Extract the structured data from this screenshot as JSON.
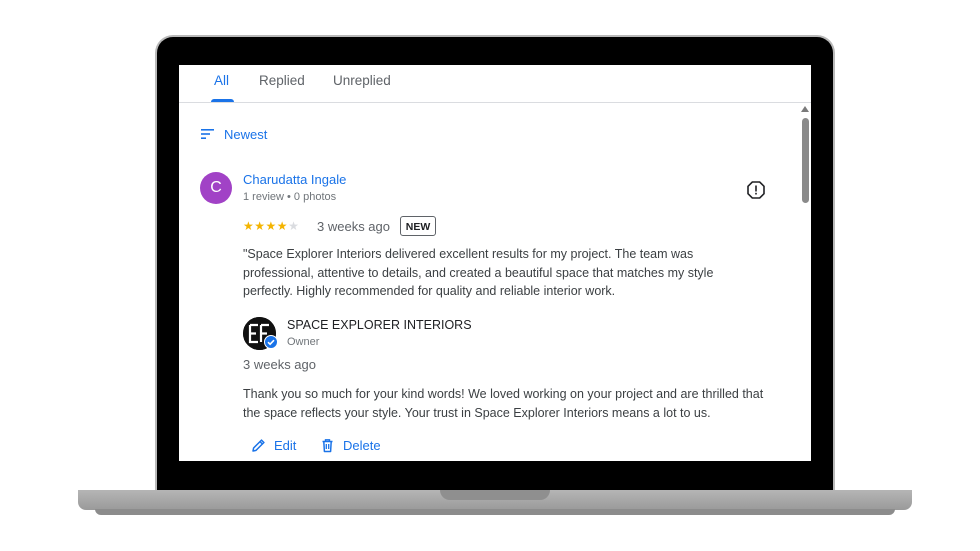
{
  "tabs": [
    {
      "label": "All",
      "active": true
    },
    {
      "label": "Replied",
      "active": false
    },
    {
      "label": "Unreplied",
      "active": false
    }
  ],
  "sort": {
    "label": "Newest",
    "icon": "sort-icon"
  },
  "review": {
    "avatar_initial": "C",
    "avatar_color": "#a142c6",
    "reviewer_name": "Charudatta Ingale",
    "reviewer_meta": "1 review • 0 photos",
    "rating": 4,
    "rating_max": 5,
    "time": "3 weeks ago",
    "badge": "NEW",
    "text": "\"Space Explorer Interiors delivered excellent results for my project. The team was professional, attentive to details, and created a beautiful space that matches my style perfectly. Highly recommended for quality and reliable interior work.",
    "report_icon": "report-icon"
  },
  "reply": {
    "owner_name": "SPACE EXPLORER INTERIORS",
    "owner_role": "Owner",
    "time": "3 weeks ago",
    "text": "Thank you so much for your kind words! We loved working on your project and are thrilled that the space reflects your style. Your trust in Space Explorer Interiors means a lot to us.",
    "verified_icon": "verified-icon"
  },
  "actions": {
    "edit_label": "Edit",
    "delete_label": "Delete"
  },
  "colors": {
    "accent": "#1a73e8",
    "star": "#f4b400",
    "text": "#3c4043",
    "muted": "#70757a"
  }
}
